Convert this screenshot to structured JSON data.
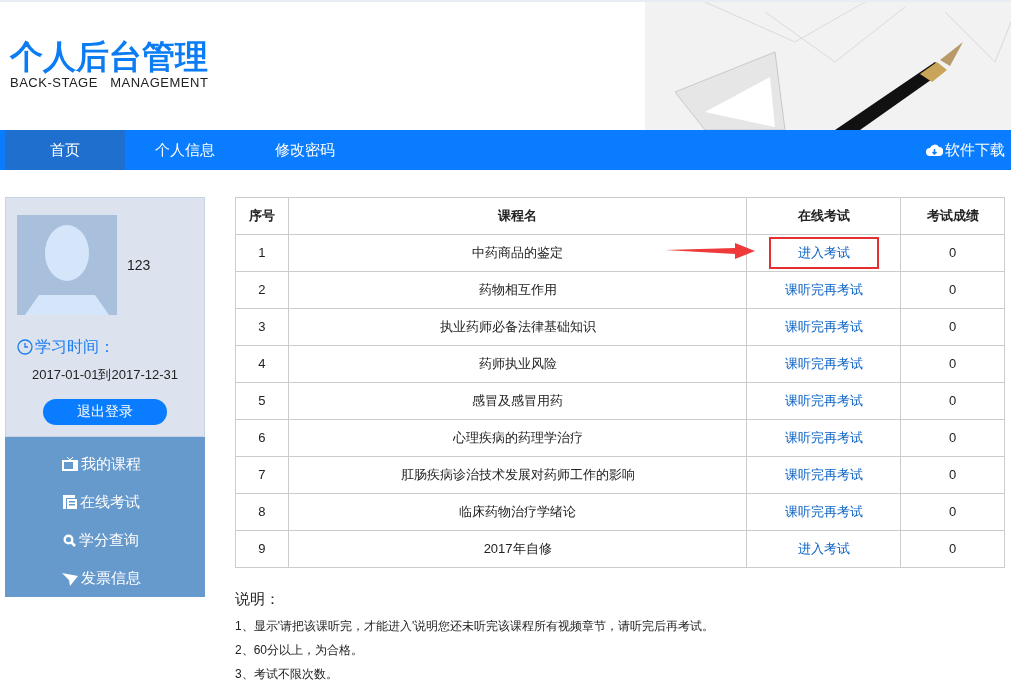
{
  "header": {
    "title": "个人后台管理",
    "subtitle": "BACK-STAGE   MANAGEMENT"
  },
  "nav": {
    "tabs": [
      {
        "label": "首页",
        "selected": true
      },
      {
        "label": "个人信息",
        "selected": false
      },
      {
        "label": "修改密码",
        "selected": false
      }
    ],
    "download": "软件下载"
  },
  "sidebar": {
    "username": "123",
    "study_time_label": "学习时间：",
    "study_time": "2017-01-01到2017-12-31",
    "logout": "退出登录",
    "menu": [
      {
        "label": "我的课程",
        "kind": "tv"
      },
      {
        "label": "在线考试",
        "kind": "doc"
      },
      {
        "label": "学分查询",
        "kind": "search"
      },
      {
        "label": "发票信息",
        "kind": "plane"
      }
    ]
  },
  "table": {
    "columns": [
      "序号",
      "课程名",
      "在线考试",
      "考试成绩"
    ],
    "rows": [
      {
        "no": "1",
        "course": "中药商品的鉴定",
        "exam": "进入考试",
        "score": "0",
        "highlighted": true
      },
      {
        "no": "2",
        "course": "药物相互作用",
        "exam": "课听完再考试",
        "score": "0",
        "highlighted": false
      },
      {
        "no": "3",
        "course": "执业药师必备法律基础知识",
        "exam": "课听完再考试",
        "score": "0",
        "highlighted": false
      },
      {
        "no": "4",
        "course": "药师执业风险",
        "exam": "课听完再考试",
        "score": "0",
        "highlighted": false
      },
      {
        "no": "5",
        "course": "感冒及感冒用药",
        "exam": "课听完再考试",
        "score": "0",
        "highlighted": false
      },
      {
        "no": "6",
        "course": "心理疾病的药理学治疗",
        "exam": "课听完再考试",
        "score": "0",
        "highlighted": false
      },
      {
        "no": "7",
        "course": "肛肠疾病诊治技术发展对药师工作的影响",
        "exam": "课听完再考试",
        "score": "0",
        "highlighted": false
      },
      {
        "no": "8",
        "course": "临床药物治疗学绪论",
        "exam": "课听完再考试",
        "score": "0",
        "highlighted": false
      },
      {
        "no": "9",
        "course": "2017年自修",
        "exam": "进入考试",
        "score": "0",
        "highlighted": false
      }
    ]
  },
  "notes": {
    "title": "说明：",
    "items": [
      "1、显示'请把该课听完，才能进入'说明您还未听完该课程所有视频章节，请听完后再考试。",
      "2、60分以上，为合格。",
      "3、考试不限次数。"
    ]
  }
}
